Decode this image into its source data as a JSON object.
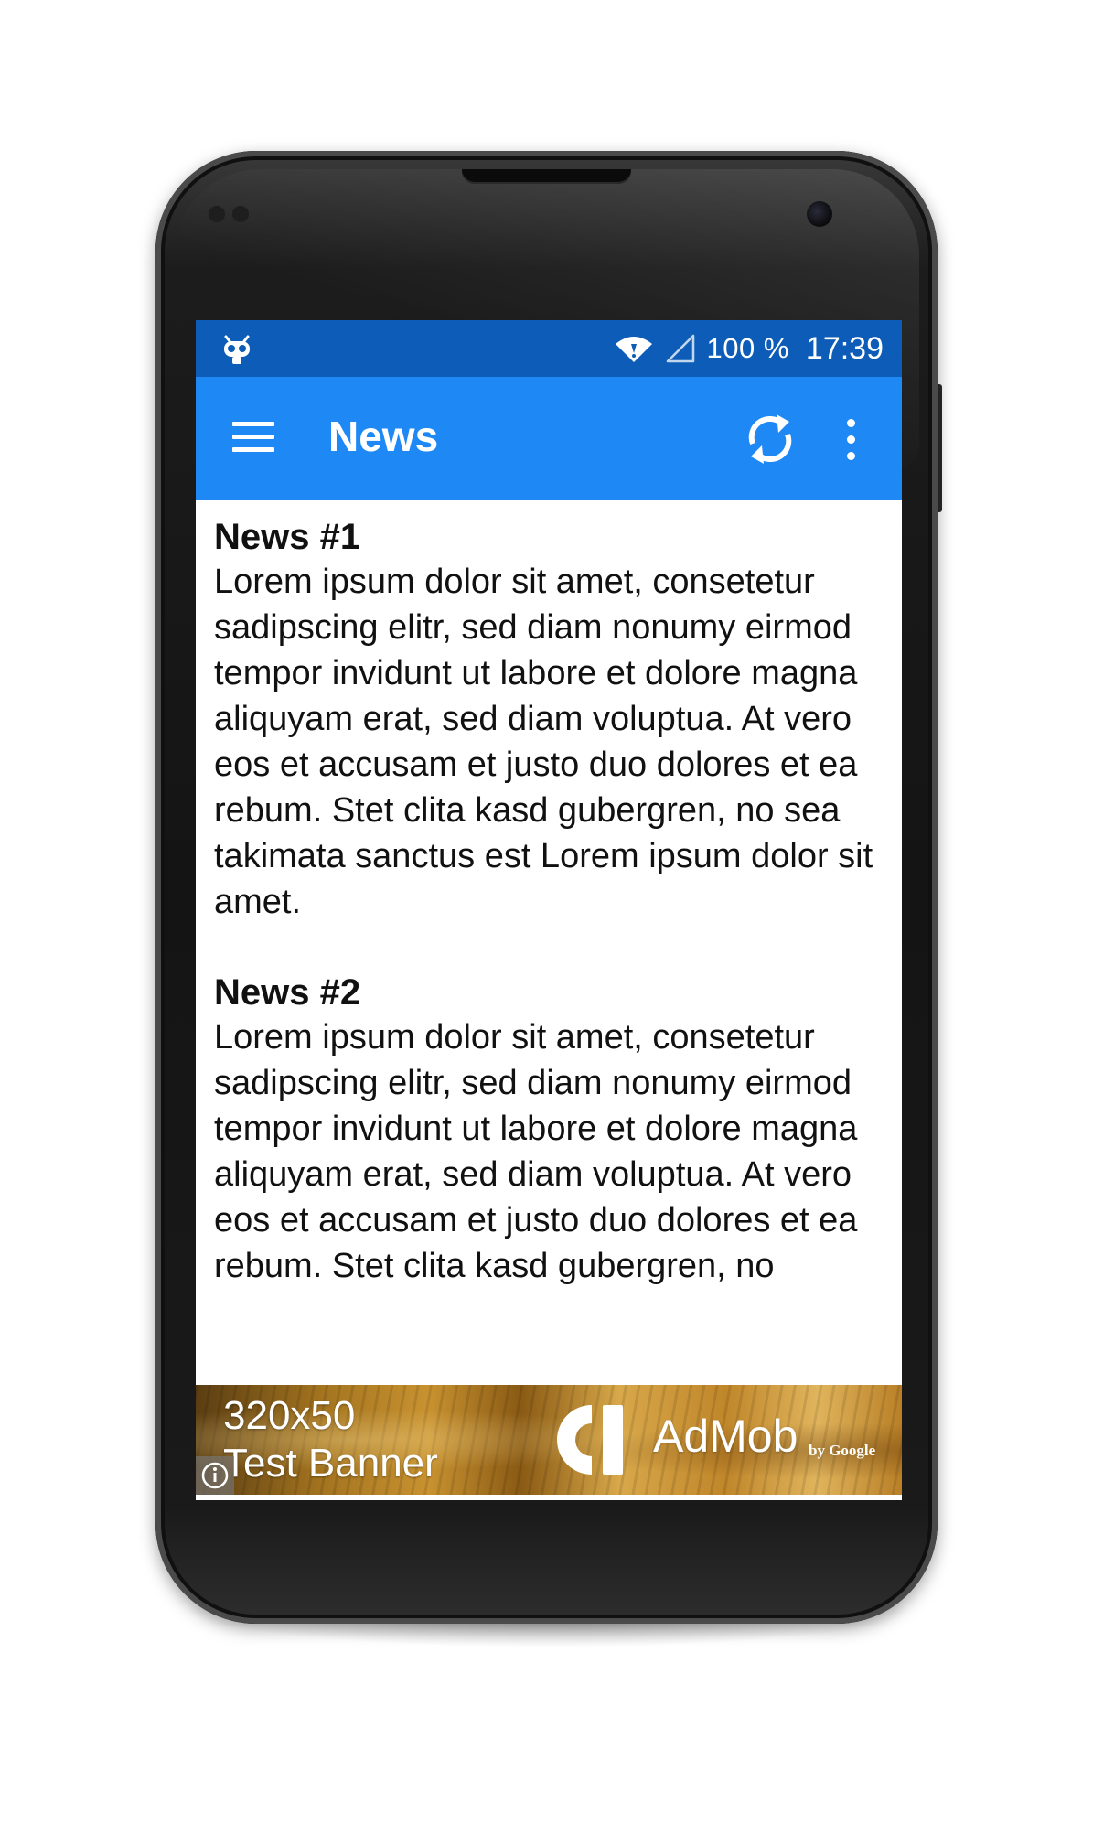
{
  "status_bar": {
    "left_icon": "cyanogen-mascot-icon",
    "wifi_icon": "wifi-icon",
    "signal_icon": "signal-icon",
    "battery_percent": "100 %",
    "time": "17:39",
    "color": "#0d5db8"
  },
  "app_bar": {
    "title": "News",
    "menu_icon": "hamburger-menu-icon",
    "refresh_icon": "refresh-icon",
    "overflow_icon": "more-vertical-icon",
    "color": "#1e88f5"
  },
  "news": [
    {
      "title": "News #1",
      "body": "Lorem ipsum dolor sit amet, consetetur sadipscing elitr, sed diam nonumy eirmod tempor invidunt ut labore et dolore magna aliquyam erat, sed diam voluptua. At vero eos et accusam et justo duo dolores et ea rebum. Stet clita kasd gubergren, no sea takimata sanctus est Lorem ipsum dolor sit amet."
    },
    {
      "title": "News #2",
      "body": "Lorem ipsum dolor sit amet, consetetur sadipscing elitr, sed diam nonumy eirmod tempor invidunt ut labore et dolore magna aliquyam erat, sed diam voluptua. At vero eos et accusam et justo duo dolores et ea rebum. Stet clita kasd gubergren, no"
    }
  ],
  "ad_banner": {
    "size_label": "320x50",
    "banner_label": "Test Banner",
    "brand": "AdMob",
    "brand_byline": "by Google",
    "info_icon": "info-icon"
  }
}
